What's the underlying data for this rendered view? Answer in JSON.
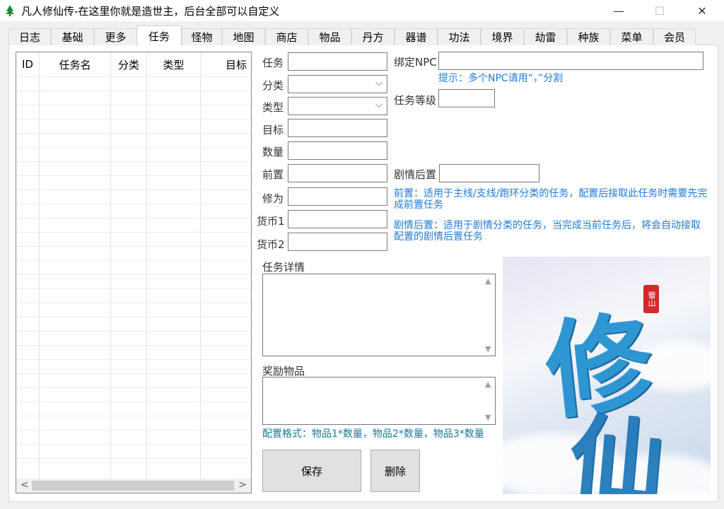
{
  "window": {
    "title": "凡人修仙传-在这里你就是造世主，后台全部可以自定义",
    "icon": "tree-icon",
    "minimize": "—",
    "maximize": "☐",
    "close": "✕"
  },
  "tabs": [
    {
      "label": "日志"
    },
    {
      "label": "基础"
    },
    {
      "label": "更多"
    },
    {
      "label": "任务",
      "active": true
    },
    {
      "label": "怪物"
    },
    {
      "label": "地图"
    },
    {
      "label": "商店"
    },
    {
      "label": "物品"
    },
    {
      "label": "丹方"
    },
    {
      "label": "器谱"
    },
    {
      "label": "功法"
    },
    {
      "label": "境界"
    },
    {
      "label": "劫雷"
    },
    {
      "label": "种族"
    },
    {
      "label": "菜单"
    },
    {
      "label": "会员"
    }
  ],
  "grid": {
    "columns": [
      "ID",
      "任务名",
      "分类",
      "类型",
      "目标"
    ],
    "rows": [],
    "scroll_left": "<",
    "scroll_right": ">"
  },
  "form": {
    "task_label": "任务",
    "category_label": "分类",
    "type_label": "类型",
    "target_label": "目标",
    "count_label": "数量",
    "prereq_label": "前置",
    "cultivation_label": "修为",
    "currency1_label": "货币1",
    "currency2_label": "货币2",
    "bind_npc_label": "绑定NPC",
    "npc_hint": "提示：多个NPC请用“，”分割",
    "task_level_label": "任务等级",
    "story_after_label": "剧情后置",
    "prereq_hint": "前置：适用于主线/支线/跑环分类的任务，配置后接取此任务时需要先完成前置任务",
    "story_hint": "剧情后置：适用于剧情分类的任务，当完成当前任务后，将会自动接取配置的剧情后置任务",
    "detail_label": "任务详情",
    "reward_label": "奖励物品",
    "reward_hint": "配置格式：物品1*数量，物品2*数量，物品3*数量",
    "save_button": "保存",
    "delete_button": "删除",
    "dropdown_glyph": "⌵"
  },
  "art": {
    "char1": "修",
    "char2": "仙",
    "seal": "蜀山"
  }
}
